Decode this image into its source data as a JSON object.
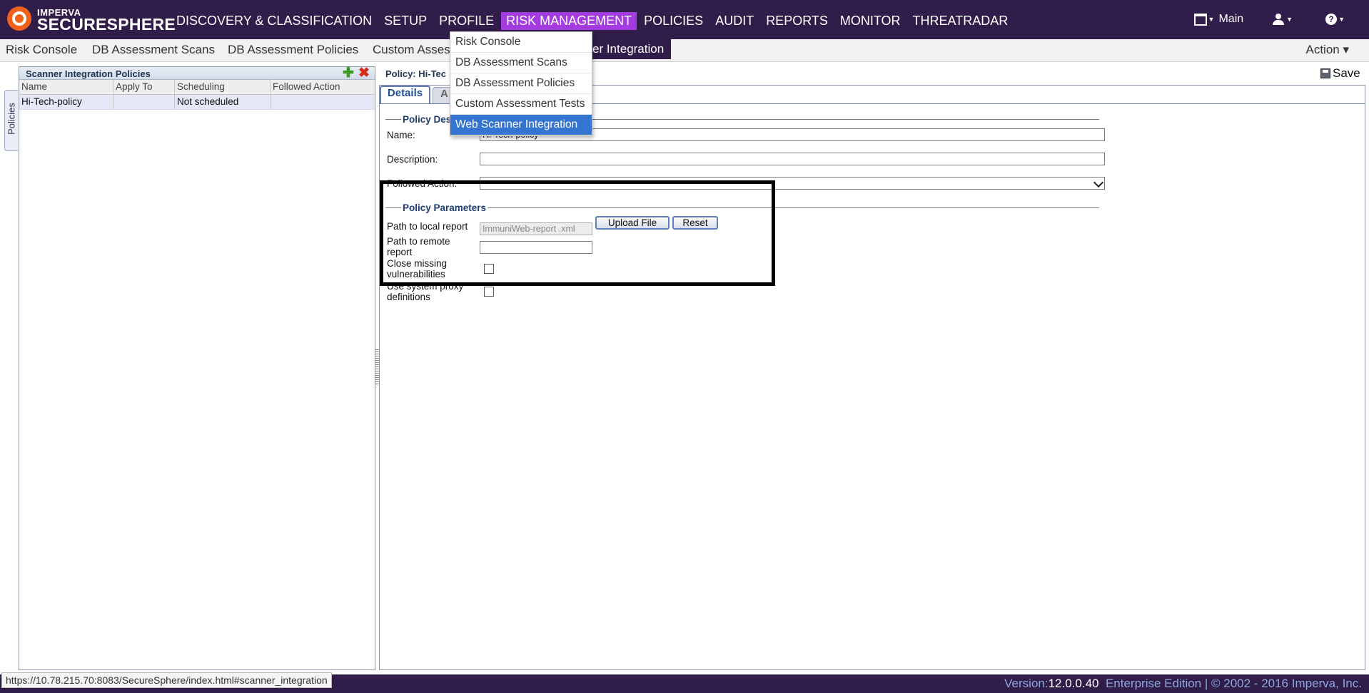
{
  "brand": {
    "top": "IMPERVA",
    "main": "SECURESPHERE"
  },
  "main_nav": [
    "DISCOVERY & CLASSIFICATION",
    "SETUP",
    "PROFILE",
    "RISK MANAGEMENT",
    "POLICIES",
    "AUDIT",
    "REPORTS",
    "MONITOR",
    "THREATRADAR"
  ],
  "top_right": {
    "workspace_label": "Main"
  },
  "sub_nav": {
    "tabs": [
      "Risk Console",
      "DB Assessment Scans",
      "DB Assessment Policies",
      "Custom Assess",
      "er Integration"
    ],
    "action_label": "Action ▾"
  },
  "dropdown": {
    "items": [
      "Risk Console",
      "DB Assessment Scans",
      "DB Assessment Policies",
      "Custom Assessment Tests",
      "Web Scanner Integration"
    ],
    "selected": "Web Scanner Integration"
  },
  "left_panel": {
    "vertical_tab": "Policies",
    "title": "Scanner Integration Policies",
    "columns": [
      "Name",
      "Apply To",
      "Scheduling",
      "Followed Action"
    ],
    "rows": [
      {
        "name": "Hi-Tech-policy",
        "apply_to": "",
        "scheduling": "Not scheduled",
        "followed_action": ""
      }
    ]
  },
  "right_panel": {
    "title": "Policy: Hi-Tec",
    "save_label": "Save",
    "tabs": [
      "Details",
      "A"
    ],
    "policy_description_legend": "Policy Des",
    "fields": {
      "name_label": "Name:",
      "name_value": "Hi-Tech-policy",
      "description_label": "Description:",
      "description_value": "",
      "followed_action_label": "Followed Action:",
      "followed_action_value": ""
    },
    "policy_parameters": {
      "legend": "Policy Parameters",
      "local_report_label": "Path to local report",
      "local_report_value": "ImmuniWeb-report .xml",
      "upload_button": "Upload File",
      "reset_button": "Reset",
      "remote_report_label": "Path to remote report",
      "remote_report_value": "",
      "close_missing_label": "Close missing vulnerabilities",
      "close_missing_checked": false,
      "proxy_label": "Use system proxy definitions",
      "proxy_checked": false
    }
  },
  "status_url": "https://10.78.215.70:8083/SecureSphere/index.html#scanner_integration",
  "footer": {
    "version_label": "Version:",
    "version_number": "12.0.0.40",
    "edition": "Enterprise Edition",
    "copyright": "| © 2002 - 2016 Imperva, Inc."
  },
  "colors": {
    "top_bar": "#301d4a",
    "active_nav": "#a33be0",
    "dropdown_selected": "#3574d0",
    "footer_text": "#8fa7dc"
  }
}
